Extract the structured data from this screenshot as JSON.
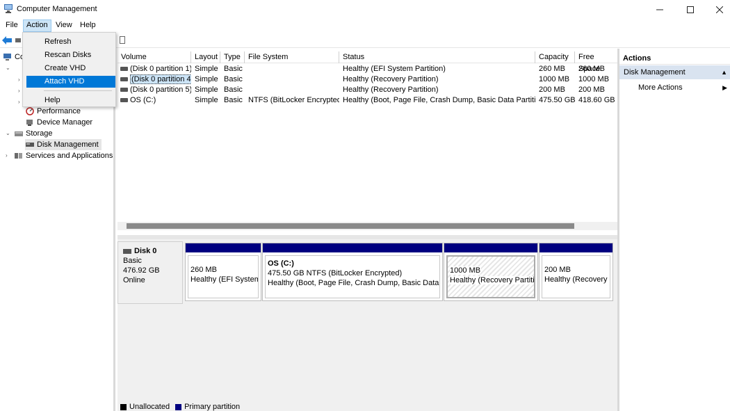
{
  "window": {
    "title": "Computer Management"
  },
  "menubar": {
    "items": [
      "File",
      "Action",
      "View",
      "Help"
    ]
  },
  "action_menu": {
    "items": [
      "Refresh",
      "Rescan Disks",
      "Create VHD",
      "Attach VHD",
      "Help"
    ],
    "highlighted": "Attach VHD"
  },
  "tree": {
    "root_partial": "Co",
    "items": [
      {
        "label": "Performance",
        "icon": "performance-icon"
      },
      {
        "label": "Device Manager",
        "icon": "device-manager-icon"
      },
      {
        "label": "Storage",
        "icon": "storage-icon"
      },
      {
        "label": "Disk Management",
        "icon": "disk-management-icon",
        "selected": true
      },
      {
        "label": "Services and Applications",
        "icon": "services-icon"
      }
    ]
  },
  "volumes": {
    "columns": [
      "Volume",
      "Layout",
      "Type",
      "File System",
      "Status",
      "Capacity",
      "Free Space"
    ],
    "rows": [
      [
        "(Disk 0 partition 1)",
        "Simple",
        "Basic",
        "",
        "Healthy (EFI System Partition)",
        "260 MB",
        "260 MB"
      ],
      [
        "(Disk 0 partition 4)",
        "Simple",
        "Basic",
        "",
        "Healthy (Recovery Partition)",
        "1000 MB",
        "1000 MB"
      ],
      [
        "(Disk 0 partition 5)",
        "Simple",
        "Basic",
        "",
        "Healthy (Recovery Partition)",
        "200 MB",
        "200 MB"
      ],
      [
        "OS (C:)",
        "Simple",
        "Basic",
        "NTFS (BitLocker Encrypted)",
        "Healthy (Boot, Page File, Crash Dump, Basic Data Partition)",
        "475.50 GB",
        "418.60 GB"
      ]
    ],
    "selected_row": 1
  },
  "disk": {
    "name": "Disk 0",
    "type": "Basic",
    "size": "476.92 GB",
    "state": "Online",
    "partitions": [
      {
        "title": "",
        "size": "260 MB",
        "status": "Healthy (EFI System P"
      },
      {
        "title": "OS  (C:)",
        "size": "475.50 GB NTFS (BitLocker Encrypted)",
        "status": "Healthy (Boot, Page File, Crash Dump, Basic Data Part"
      },
      {
        "title": "",
        "size": "1000 MB",
        "status": "Healthy (Recovery Partition",
        "selected": true
      },
      {
        "title": "",
        "size": "200 MB",
        "status": "Healthy (Recovery Pa"
      }
    ]
  },
  "legend": [
    {
      "label": "Unallocated",
      "color": "#000000"
    },
    {
      "label": "Primary partition",
      "color": "#000080"
    }
  ],
  "actions": {
    "header": "Actions",
    "section": "Disk Management",
    "items": [
      "More Actions"
    ]
  }
}
